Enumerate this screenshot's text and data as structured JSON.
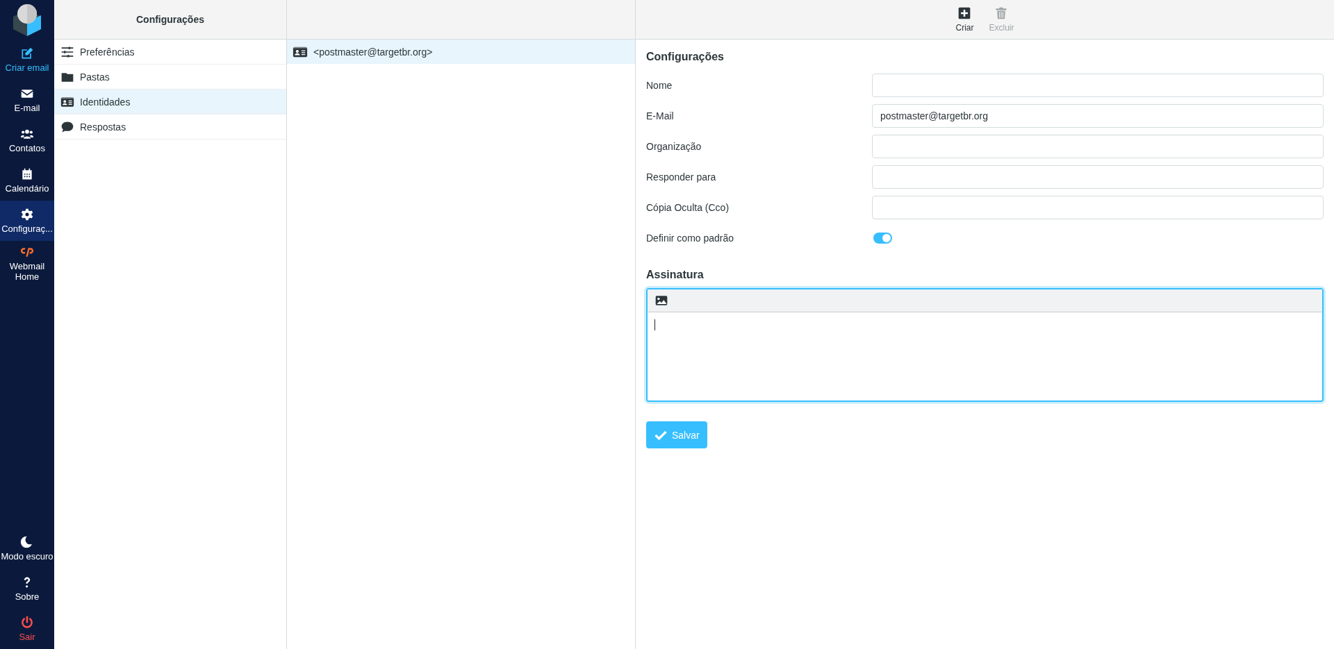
{
  "nav": {
    "top": [
      {
        "label": "Criar email",
        "kind": "accent",
        "selected": false
      },
      {
        "label": "E-mail",
        "kind": "normal",
        "selected": false
      },
      {
        "label": "Contatos",
        "kind": "normal",
        "selected": false
      },
      {
        "label": "Calendário",
        "kind": "normal",
        "selected": false
      },
      {
        "label": "Configuraç...",
        "kind": "normal",
        "selected": true
      },
      {
        "label": "Webmail Home",
        "kind": "normal",
        "selected": false
      }
    ],
    "bottom": [
      {
        "label": "Modo escuro",
        "kind": "normal",
        "selected": false
      },
      {
        "label": "Sobre",
        "kind": "normal",
        "selected": false
      },
      {
        "label": "Sair",
        "kind": "danger",
        "selected": false
      }
    ]
  },
  "settings": {
    "title": "Configurações",
    "items": [
      {
        "label": "Preferências",
        "selected": false
      },
      {
        "label": "Pastas",
        "selected": false
      },
      {
        "label": "Identidades",
        "selected": true
      },
      {
        "label": "Respostas",
        "selected": false
      }
    ]
  },
  "identities": [
    {
      "label": "<postmaster@targetbr.org>",
      "selected": true
    }
  ],
  "toolbar": [
    {
      "label": "Criar",
      "disabled": false
    },
    {
      "label": "Excluir",
      "disabled": true
    }
  ],
  "form": {
    "title": "Configurações",
    "fields": [
      {
        "label": "Nome",
        "kind": "text"
      },
      {
        "label": "E-Mail",
        "kind": "text",
        "value": "postmaster@targetbr.org"
      },
      {
        "label": "Organização",
        "kind": "text"
      },
      {
        "label": "Responder para",
        "kind": "text"
      },
      {
        "label": "Cópia Oculta (Cco)",
        "kind": "text"
      },
      {
        "label": "Definir como padrão",
        "kind": "toggle",
        "on": true
      }
    ],
    "signature_title": "Assinatura",
    "save_button": "Salvar"
  }
}
